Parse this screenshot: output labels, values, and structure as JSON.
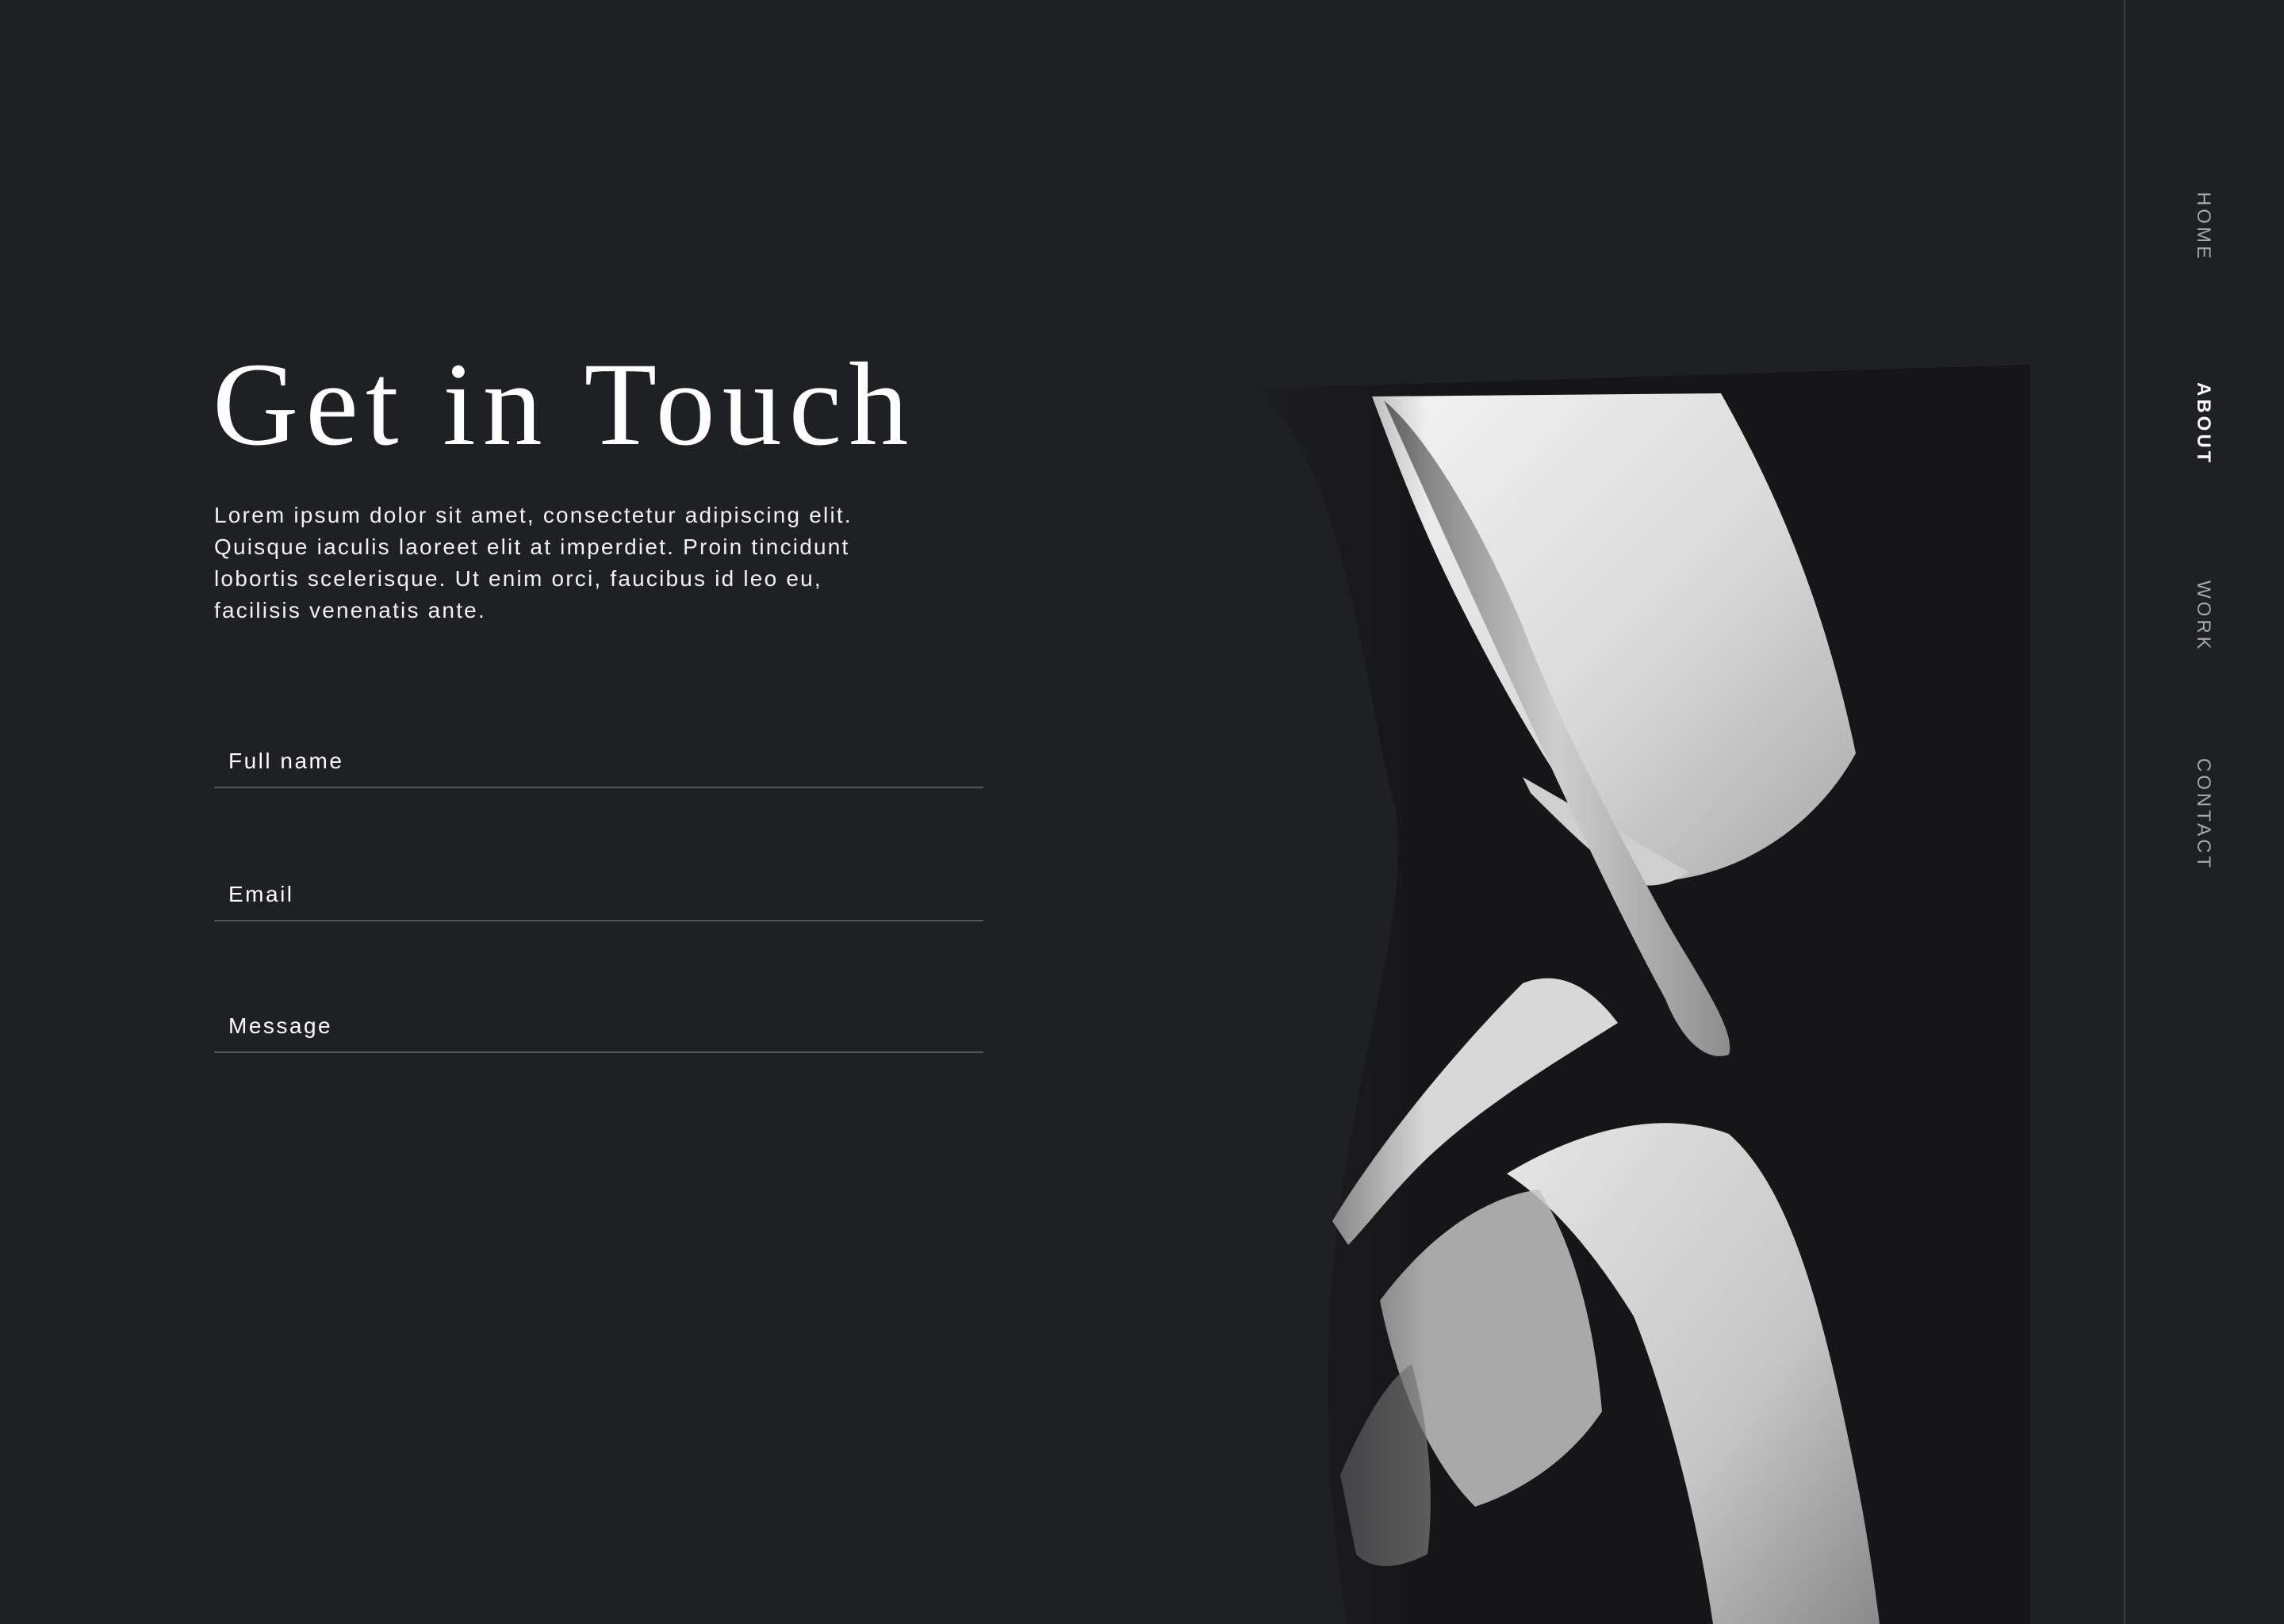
{
  "colors": {
    "background": "#1f2023",
    "text": "#ffffff",
    "nav_inactive": "#a7a8ab",
    "underline": "#55565a"
  },
  "hero": {
    "title": "Get in Touch",
    "intro": "Lorem ipsum dolor sit amet, consectetur adipiscing elit. Quisque iaculis laoreet elit at imperdiet. Proin tincidunt lobortis scelerisque. Ut enim orci, faucibus id leo eu, facilisis venenatis ante."
  },
  "form": {
    "fields": [
      {
        "label": "Full name",
        "value": ""
      },
      {
        "label": "Email",
        "value": ""
      },
      {
        "label": "Message",
        "value": ""
      }
    ]
  },
  "nav": {
    "items": [
      {
        "label": "HOME",
        "active": false
      },
      {
        "label": "ABOUT",
        "active": true
      },
      {
        "label": "WORK",
        "active": false
      },
      {
        "label": "CONTACT",
        "active": false
      }
    ]
  }
}
